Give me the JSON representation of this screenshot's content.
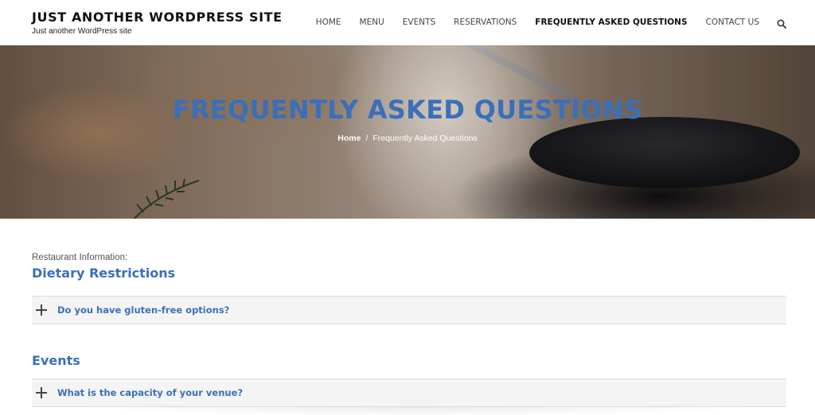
{
  "site": {
    "title": "JUST ANOTHER WORDPRESS SITE",
    "tagline": "Just another WordPress site"
  },
  "nav": {
    "items": [
      {
        "label": "HOME",
        "active": false
      },
      {
        "label": "MENU",
        "active": false
      },
      {
        "label": "EVENTS",
        "active": false
      },
      {
        "label": "RESERVATIONS",
        "active": false
      },
      {
        "label": "FREQUENTLY ASKED QUESTIONS",
        "active": true
      },
      {
        "label": "CONTACT US",
        "active": false
      }
    ],
    "search_icon": "search-icon"
  },
  "hero": {
    "title": "FREQUENTLY ASKED QUESTIONS",
    "breadcrumb": {
      "home": "Home",
      "separator": "/",
      "current": "Frequently Asked Questions"
    }
  },
  "faq": {
    "intro_label": "Restaurant Information:",
    "sections": [
      {
        "title": "Dietary Restrictions",
        "questions": [
          "Do you have gluten-free options?"
        ]
      },
      {
        "title": "Events",
        "questions": [
          "What is the capacity of your venue?"
        ]
      }
    ]
  },
  "colors": {
    "accent": "#3b6fb8",
    "row_background": "#f4f4f4"
  }
}
